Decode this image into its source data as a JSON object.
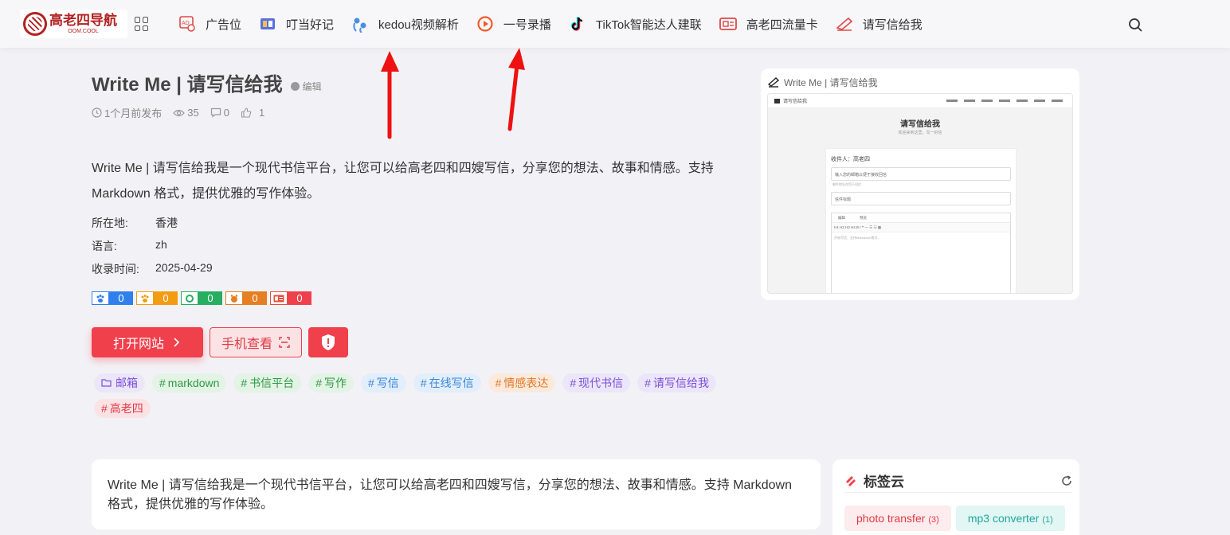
{
  "brand": {
    "logo_title": "高老四导航",
    "logo_sub": "OOM.COOL"
  },
  "nav": [
    {
      "label": "广告位",
      "icon": "ad-icon"
    },
    {
      "label": "叮当好记",
      "icon": "book-icon"
    },
    {
      "label": "kedou视频解析",
      "icon": "tadpole-icon"
    },
    {
      "label": "一号录播",
      "icon": "record-icon"
    },
    {
      "label": "TikTok智能达人建联",
      "icon": "tiktok-icon"
    },
    {
      "label": "高老四流量卡",
      "icon": "sim-card-icon"
    },
    {
      "label": "请写信给我",
      "icon": "write-icon"
    }
  ],
  "site": {
    "title": "Write Me | 请写信给我",
    "edit": "编辑",
    "published": "1个月前发布",
    "views": "35",
    "comments": "0",
    "likes": "1",
    "description": "Write Me | 请写信给我是一个现代书信平台，让您可以给高老四和四嫂写信，分享您的想法、故事和情感。支持 Markdown 格式，提供优雅的写作体验。",
    "location_label": "所在地:",
    "location": "香港",
    "language_label": "语言:",
    "language": "zh",
    "collected_label": "收录时间:",
    "collected": "2025-04-29"
  },
  "badges": [
    {
      "value": "0",
      "color": "#2f80ed"
    },
    {
      "value": "0",
      "color": "#f39c12"
    },
    {
      "value": "0",
      "color": "#27ae60"
    },
    {
      "value": "0",
      "color": "#e67e22"
    },
    {
      "value": "0",
      "color": "#e74c3c"
    }
  ],
  "buttons": {
    "open": "打开网站",
    "mobile": "手机查看"
  },
  "tags": [
    {
      "label": "邮箱",
      "prefix": "",
      "bg": "#ece6fb",
      "fg": "#7a4fd6"
    },
    {
      "label": "markdown",
      "prefix": "#",
      "bg": "#e3f3e5",
      "fg": "#2e9a43"
    },
    {
      "label": "书信平台",
      "prefix": "#",
      "bg": "#e3f3e5",
      "fg": "#2e9a43"
    },
    {
      "label": "写作",
      "prefix": "#",
      "bg": "#e3f3e5",
      "fg": "#2e9a43"
    },
    {
      "label": "写信",
      "prefix": "#",
      "bg": "#e2eefb",
      "fg": "#3a86d8"
    },
    {
      "label": "在线写信",
      "prefix": "#",
      "bg": "#e2eefb",
      "fg": "#3a86d8"
    },
    {
      "label": "情感表达",
      "prefix": "#",
      "bg": "#fbeadb",
      "fg": "#e0782a"
    },
    {
      "label": "现代书信",
      "prefix": "#",
      "bg": "#ece6fb",
      "fg": "#7a4fd6"
    },
    {
      "label": "请写信给我",
      "prefix": "#",
      "bg": "#ece6fb",
      "fg": "#7a4fd6"
    },
    {
      "label": "高老四",
      "prefix": "#",
      "bg": "#fbe3e5",
      "fg": "#e03a46"
    }
  ],
  "preview": {
    "caption": "Write Me | 请写信给我",
    "app_name": "请写信给我",
    "heading": "请写信给我",
    "subtitle": "欢迎来到这里，写一封信",
    "to": "收件人：高老四",
    "email_ph": "输入您的邮箱以便于接收回信",
    "email_hint": "邮件地址仅用于回信",
    "subject_ph": "信件标题",
    "tab_edit": "编辑",
    "tab_preview": "预览",
    "toolbar": "H1 H2 H3 H4 B I ❝ — ☰ ☷ ▦",
    "body_ph": "开始写信，支持Markdown格式..."
  },
  "summary": "Write Me | 请写信给我是一个现代书信平台，让您可以给高老四和四嫂写信，分享您的想法、故事和情感。支持 Markdown 格式，提供优雅的写作体验。",
  "tagcloud": {
    "title": "标签云",
    "items": [
      {
        "label": "photo transfer",
        "count": "(3)",
        "bg": "#fdeced",
        "fg": "#e03a46"
      },
      {
        "label": "mp3 converter",
        "count": "(1)",
        "bg": "#e2f6f4",
        "fg": "#1fa89a"
      }
    ]
  },
  "colors": {
    "accent": "#f0404c",
    "arrow": "#ee1111"
  }
}
